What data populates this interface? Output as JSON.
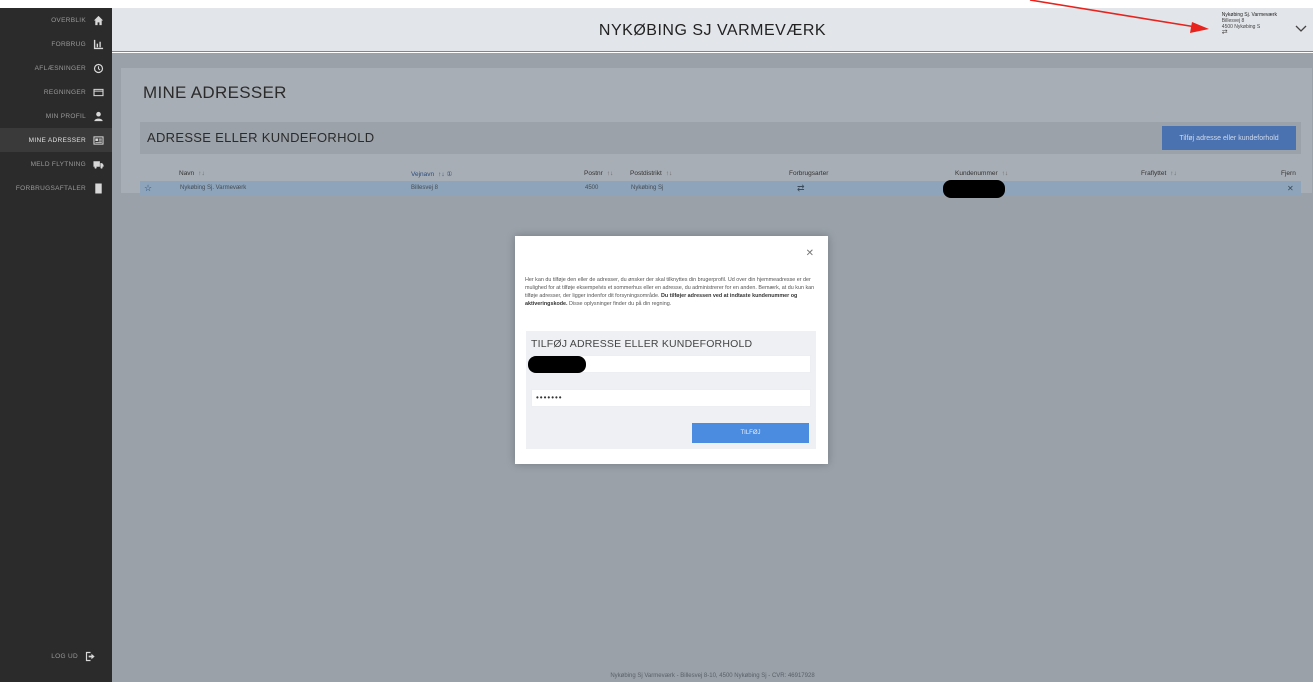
{
  "sidebar": {
    "items": [
      {
        "label": "OVERBLIK",
        "icon": "home-icon"
      },
      {
        "label": "FORBRUG",
        "icon": "chart-icon"
      },
      {
        "label": "AFLÆSNINGER",
        "icon": "clock-icon"
      },
      {
        "label": "REGNINGER",
        "icon": "card-icon"
      },
      {
        "label": "MIN PROFIL",
        "icon": "user-icon"
      },
      {
        "label": "MINE ADRESSER",
        "icon": "id-card-icon"
      },
      {
        "label": "MELD FLYTNING",
        "icon": "truck-icon"
      },
      {
        "label": "FORBRUGSAFTALER",
        "icon": "document-icon"
      }
    ],
    "active": "MINE ADRESSER",
    "logout": "LOG UD"
  },
  "header": {
    "title": "NYKØBING SJ VARMEVÆRK",
    "account": {
      "name": "Nykøbing Sj. Varmeværk",
      "street": "Billesvej 8",
      "city": "4500 Nykøbing S"
    }
  },
  "page": {
    "title": "MINE ADRESSER",
    "section_title": "ADRESSE ELLER KUNDEFORHOLD",
    "add_button": "Tilføj adresse eller kundeforhold"
  },
  "table": {
    "columns": [
      "Navn",
      "Vejnavn",
      "Postnr",
      "Postdistrikt",
      "Forbrugsarter",
      "Kundenummer",
      "Fraflyttet",
      "Fjern"
    ],
    "rows": [
      {
        "navn": "Nykøbing Sj. Varmeværk",
        "vejnavn": "Billesvej 8",
        "postnr": "4500",
        "postdistrikt": "Nykøbing Sj",
        "fjern": "✕"
      }
    ]
  },
  "footer": "Nykøbing Sj Varmeværk - Billesvej 8-10, 4500 Nykøbing Sj - CVR: 46917928",
  "modal": {
    "text_plain": "Her kan du tilføje den eller de adresser, du ønsker der skal tilknyttes din brugerprofil. Ud over din hjemmeadresse er der mulighed for at tilføje eksempelvis et sommerhus eller en adresse, du administrerer for en anden. Bemærk, at du kun kan tilføje adresser, der ligger indenfor dit forsyningsområde. ",
    "text_bold": "Du tilføjer adressen ved at indtaste kundenummer og aktiveringskode.",
    "text_tail": " Disse oplysninger finder du på din regning.",
    "form_title": "TILFØJ ADRESSE ELLER KUNDEFORHOLD",
    "password_value": "•••••••",
    "submit": "TILFØJ"
  },
  "colors": {
    "sidebar": "#2b2b2b",
    "accent": "#4b8be0",
    "annotation_arrow": "#e8231d"
  }
}
